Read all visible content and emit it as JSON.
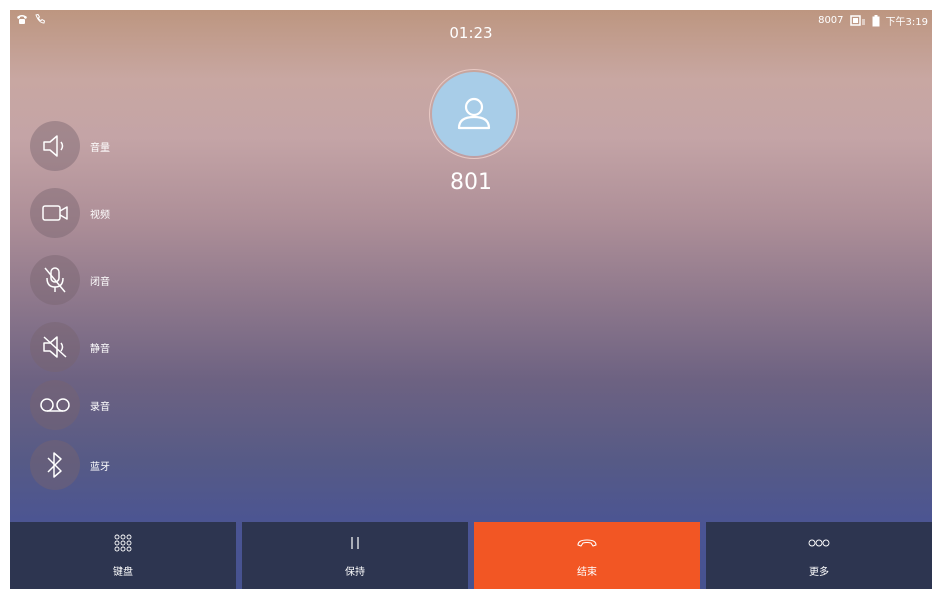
{
  "status_bar": {
    "extension": "8007",
    "time": "下午3:19",
    "icons": [
      "phone-icon",
      "call-icon",
      "screen-icon",
      "battery-icon"
    ]
  },
  "call": {
    "duration": "01:23",
    "number": "801",
    "avatar_icon": "user-icon"
  },
  "side_controls": [
    {
      "label": "音量",
      "icon": "volume-icon"
    },
    {
      "label": "视频",
      "icon": "video-icon"
    },
    {
      "label": "闭音",
      "icon": "mic-off-icon"
    },
    {
      "label": "静音",
      "icon": "speaker-mute-icon"
    },
    {
      "label": "录音",
      "icon": "voicemail-icon"
    },
    {
      "label": "蓝牙",
      "icon": "bluetooth-icon"
    }
  ],
  "bottom_bar": [
    {
      "label": "键盘",
      "icon": "keypad-icon"
    },
    {
      "label": "保持",
      "icon": "pause-icon"
    },
    {
      "label": "结束",
      "icon": "hangup-icon"
    },
    {
      "label": "更多",
      "icon": "more-icon"
    }
  ],
  "colors": {
    "end_call": "#f25624",
    "bottom_button": "#2d3550",
    "avatar": "#a8cde8"
  }
}
